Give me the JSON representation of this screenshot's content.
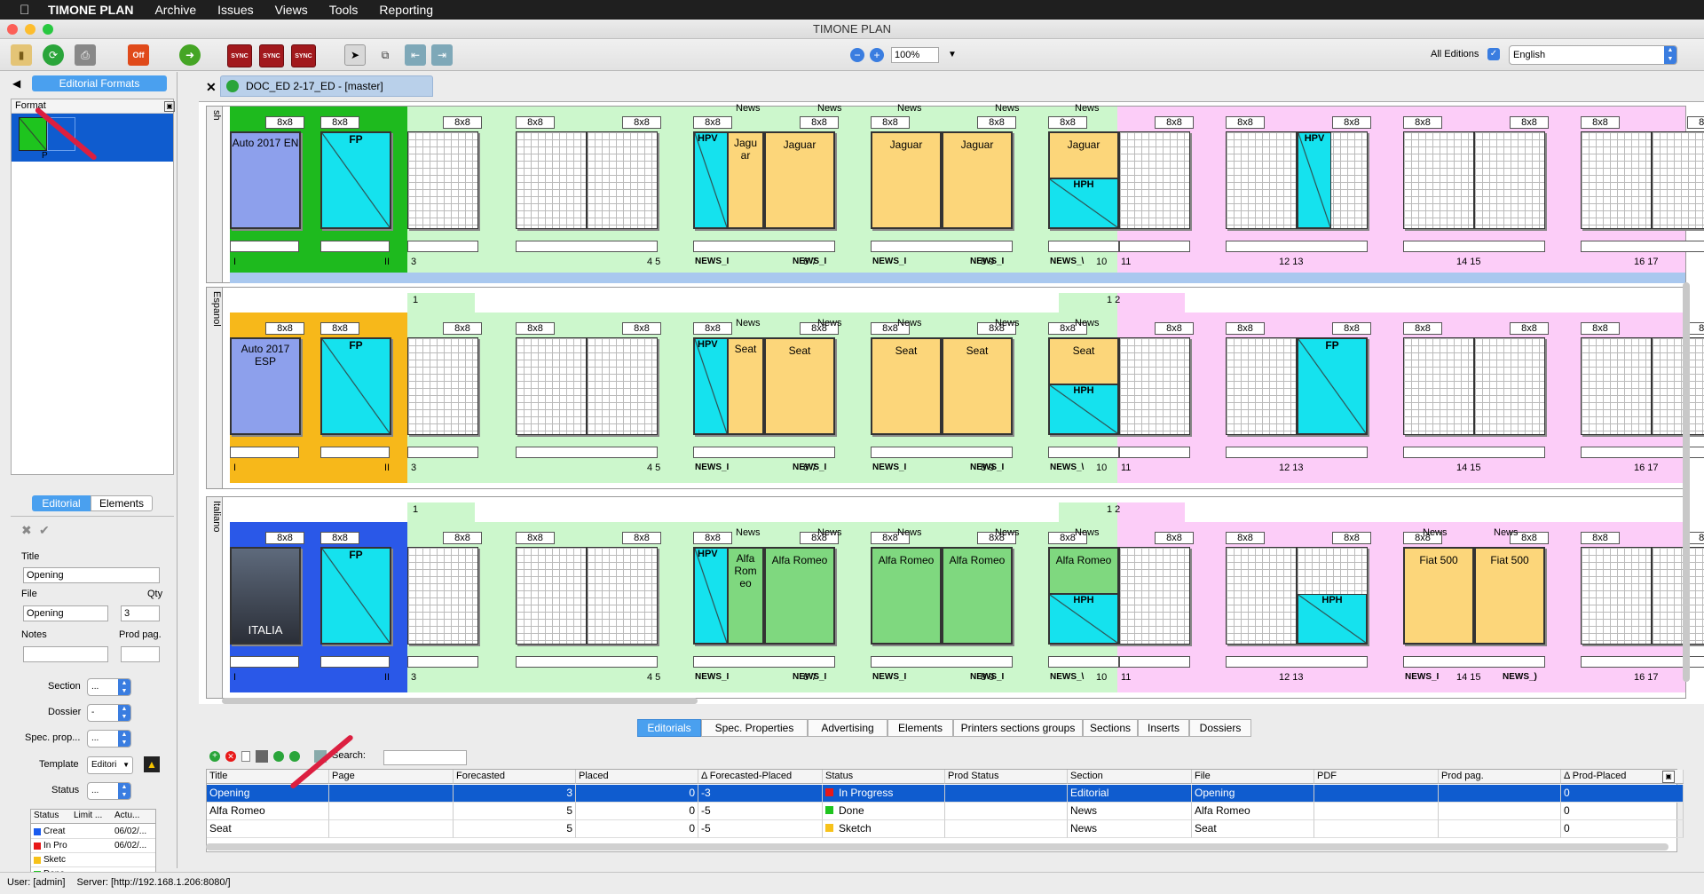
{
  "menubar": {
    "app": "TIMONE PLAN",
    "items": [
      "Archive",
      "Issues",
      "Views",
      "Tools",
      "Reporting"
    ]
  },
  "window": {
    "title": "TIMONE PLAN"
  },
  "toolbar": {
    "zoom": "100%",
    "all_editions_label": "All Editions",
    "language": "English",
    "off_label": "Off",
    "sync_label": "SYNC"
  },
  "left": {
    "panel_title": "Editorial Formats",
    "format_header": "Format",
    "format_item": "P",
    "tabs": [
      "Editorial",
      "Elements"
    ],
    "title_label": "Title",
    "title_value": "Opening",
    "file_label": "File",
    "file_value": "Opening",
    "qty_label": "Qty",
    "qty_value": "3",
    "notes_label": "Notes",
    "prodpag_label": "Prod pag.",
    "section_label": "Section",
    "section_value": "...",
    "dossier_label": "Dossier",
    "dossier_value": "-",
    "specprop_label": "Spec. prop...",
    "specprop_value": "...",
    "template_label": "Template",
    "template_value": "Editori",
    "status_label": "Status",
    "status_value": "...",
    "status_table": {
      "headers": [
        "Status",
        "Limit ...",
        "Actu..."
      ],
      "rows": [
        {
          "status": "Creat",
          "limit": "",
          "actual": "06/02/...",
          "color": "#1a5bef"
        },
        {
          "status": "In Pro",
          "limit": "",
          "actual": "06/02/...",
          "color": "#e81818"
        },
        {
          "status": "Sketc",
          "limit": "",
          "actual": "",
          "color": "#f7c21a"
        },
        {
          "status": "Done",
          "limit": "",
          "actual": "",
          "color": "#1ec41e"
        }
      ]
    }
  },
  "doc": {
    "tab_title": "DOC_ED 2-17_ED - [master]"
  },
  "rows": [
    {
      "label": "sh",
      "cover_color": "#1eba1e",
      "cover_title": "Auto 2017 EN",
      "top_nums": [
        "",
        ""
      ],
      "s4_text": "Jaguar",
      "s4_narrow": "Jagu ar",
      "s4_blocks_color": "yellow",
      "s5a": "Jaguar",
      "s5b": "Jaguar",
      "s6_text": "Jaguar",
      "s8_has_hpv": true
    },
    {
      "label": "Espanol",
      "cover_color": "#f7b81a",
      "cover_title": "Auto 2017 ESP",
      "top_nums": [
        "1",
        "1 2"
      ],
      "s4_text": "Seat",
      "s4_narrow": "Seat",
      "s4_blocks_color": "yellow",
      "s5a": "Seat",
      "s5b": "Seat",
      "s6_text": "Seat",
      "s8_has_hpv": false
    },
    {
      "label": "Italiano",
      "cover_color": "#2a58e8",
      "cover_title": "",
      "cover_image_text": "ITALIA",
      "top_nums": [
        "1",
        "1 2"
      ],
      "s4_text": "Alfa Romeo",
      "s4_narrow": "Alfa Rom eo",
      "s4_blocks_color": "green",
      "s5a": "Alfa Romeo",
      "s5b": "Alfa Romeo",
      "s6_text": "Alfa Romeo",
      "s8_has_hpv": false
    }
  ],
  "page_labels": {
    "format": "8x8",
    "news": "News",
    "fp": "FP",
    "hpv": "HPV",
    "hph": "HPH",
    "fiat": "Fiat 500",
    "news_a": "NEWS_I",
    "news_b": "NEWS_\\",
    "news_c": "NEWS_)",
    "n_i": "I",
    "n_ii": "II",
    "n3": "3",
    "n45": "4  5",
    "n67": "6  7",
    "n89": "8  9",
    "n10": "10",
    "n11": "11",
    "n1213": "12  13",
    "n1415": "14  15",
    "n1617": "16  17"
  },
  "bottom": {
    "tabs": [
      "Editorials",
      "Spec. Properties",
      "Advertising",
      "Elements",
      "Printers sections groups",
      "Sections",
      "Inserts",
      "Dossiers"
    ],
    "search_label": "Search:",
    "columns": [
      "Title",
      "Page",
      "Forecasted",
      "Placed",
      "Δ Forecasted-Placed",
      "Status",
      "Prod Status",
      "Section",
      "File",
      "PDF",
      "Prod pag.",
      "Δ Prod-Placed"
    ],
    "rows": [
      {
        "title": "Opening",
        "page": "",
        "forecasted": "3",
        "placed": "0",
        "delta": "-3",
        "status": "In Progress",
        "status_color": "#e81818",
        "prod": "",
        "section": "Editorial",
        "file": "Opening",
        "pdf": "",
        "prodpag": "",
        "dp": "0",
        "selected": true
      },
      {
        "title": "Alfa Romeo",
        "page": "",
        "forecasted": "5",
        "placed": "0",
        "delta": "-5",
        "status": "Done",
        "status_color": "#1ec41e",
        "prod": "",
        "section": "News",
        "file": "Alfa Romeo",
        "pdf": "",
        "prodpag": "",
        "dp": "0",
        "selected": false
      },
      {
        "title": "Seat",
        "page": "",
        "forecasted": "5",
        "placed": "0",
        "delta": "-5",
        "status": "Sketch",
        "status_color": "#f7c21a",
        "prod": "",
        "section": "News",
        "file": "Seat",
        "pdf": "",
        "prodpag": "",
        "dp": "0",
        "selected": false
      }
    ]
  },
  "statusbar": {
    "user": "User: [admin]",
    "server": "Server: [http://192.168.1.206:8080/]"
  }
}
